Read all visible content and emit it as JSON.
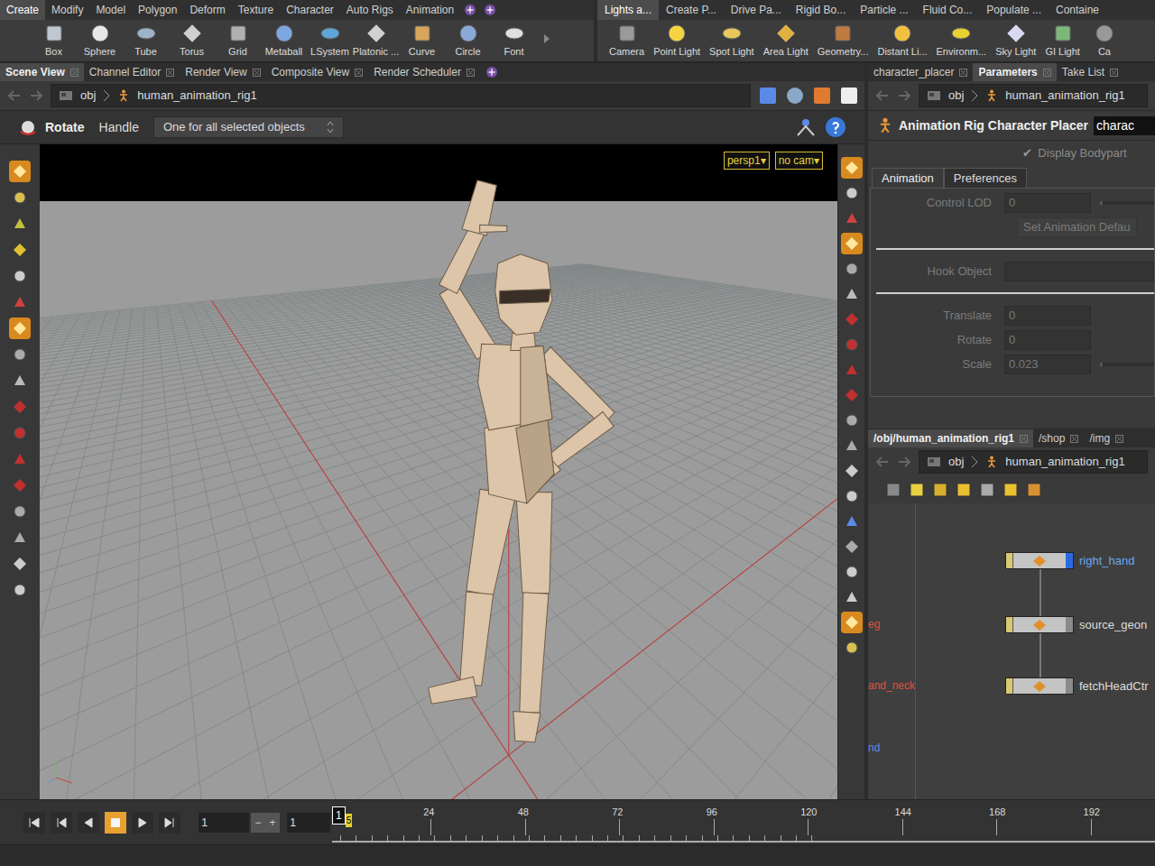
{
  "shelf_left": {
    "tabs": [
      {
        "label": "Create",
        "selected": true
      },
      {
        "label": "Modify",
        "selected": false
      },
      {
        "label": "Model",
        "selected": false
      },
      {
        "label": "Polygon",
        "selected": false
      },
      {
        "label": "Deform",
        "selected": false
      },
      {
        "label": "Texture",
        "selected": false
      },
      {
        "label": "Character",
        "selected": false
      },
      {
        "label": "Auto Rigs",
        "selected": false
      },
      {
        "label": "Animation",
        "selected": false
      }
    ],
    "tools": [
      "Box",
      "Sphere",
      "Tube",
      "Torus",
      "Grid",
      "Metaball",
      "LSystem",
      "Platonic ...",
      "Curve",
      "Circle",
      "Font"
    ]
  },
  "shelf_right": {
    "tabs": [
      {
        "label": "Lights a...",
        "selected": true
      },
      {
        "label": "Create P...",
        "selected": false
      },
      {
        "label": "Drive Pa...",
        "selected": false
      },
      {
        "label": "Rigid Bo...",
        "selected": false
      },
      {
        "label": "Particle ...",
        "selected": false
      },
      {
        "label": "Fluid Co...",
        "selected": false
      },
      {
        "label": "Populate ...",
        "selected": false
      },
      {
        "label": "Containe",
        "selected": false
      }
    ],
    "tools": [
      "Camera",
      "Point Light",
      "Spot Light",
      "Area Light",
      "Geometry...",
      "Distant Li...",
      "Environm...",
      "Sky Light",
      "GI Light",
      "Ca"
    ]
  },
  "scene_tabs": [
    {
      "label": "Scene View",
      "selected": true
    },
    {
      "label": "Channel Editor",
      "selected": false
    },
    {
      "label": "Render View",
      "selected": false
    },
    {
      "label": "Composite View",
      "selected": false
    },
    {
      "label": "Render Scheduler",
      "selected": false
    }
  ],
  "scene_path": {
    "root": "obj",
    "node": "human_animation_rig1"
  },
  "operation": {
    "tool": "Rotate",
    "mode": "Handle",
    "dropdown": "One for all selected objects"
  },
  "viewport": {
    "camera": "persp1",
    "view": "no cam",
    "dropdown_glyph": "▾"
  },
  "left_toolbar": [
    {
      "selected": true
    },
    {
      "selected": false
    },
    {
      "selected": false
    },
    {
      "selected": false
    },
    {
      "selected": false
    },
    {
      "selected": false
    },
    {
      "selected": true
    },
    {
      "selected": false
    },
    {
      "selected": false
    },
    {
      "selected": false
    },
    {
      "selected": false
    },
    {
      "selected": false
    },
    {
      "selected": false
    },
    {
      "selected": false
    },
    {
      "selected": false
    },
    {
      "selected": false
    },
    {
      "selected": false
    }
  ],
  "right_toolbar": [
    {
      "selected": true
    },
    {
      "selected": false
    },
    {
      "selected": false
    },
    {
      "selected": true
    },
    {
      "selected": false
    },
    {
      "selected": false
    },
    {
      "selected": false
    },
    {
      "selected": false
    },
    {
      "selected": false
    },
    {
      "selected": false
    },
    {
      "selected": false
    },
    {
      "selected": false
    },
    {
      "selected": false
    },
    {
      "selected": false
    },
    {
      "selected": false
    },
    {
      "selected": false
    },
    {
      "selected": false
    },
    {
      "selected": false
    },
    {
      "selected": true
    },
    {
      "selected": false
    }
  ],
  "param_tabs": [
    {
      "label": "character_placer",
      "selected": false
    },
    {
      "label": "Parameters",
      "selected": true
    },
    {
      "label": "Take List",
      "selected": false
    }
  ],
  "param_path": {
    "root": "obj",
    "node": "human_animation_rig1"
  },
  "parameters": {
    "type": "Animation Rig Character Placer",
    "name": "charac",
    "display_bodypart": {
      "label": "Display Bodypart",
      "checked": true
    },
    "tabs": [
      {
        "label": "Animation",
        "selected": true
      },
      {
        "label": "Preferences",
        "selected": false
      }
    ],
    "disabled": true,
    "rows": [
      {
        "kind": "slider",
        "label": "Control LOD",
        "value": "0"
      },
      {
        "kind": "button",
        "label": "Set Animation Defau"
      },
      {
        "kind": "separator"
      },
      {
        "kind": "text",
        "label": "Hook Object",
        "value": ""
      },
      {
        "kind": "separator"
      },
      {
        "kind": "number",
        "label": "Translate",
        "value": "0"
      },
      {
        "kind": "number",
        "label": "Rotate",
        "value": "0"
      },
      {
        "kind": "slider",
        "label": "Scale",
        "value": "0.023"
      }
    ]
  },
  "network_tabs": [
    {
      "label": "/obj/human_animation_rig1",
      "selected": true
    },
    {
      "label": "/shop",
      "selected": false
    },
    {
      "label": "/img",
      "selected": false
    }
  ],
  "network_path": {
    "root": "obj",
    "node": "human_animation_rig1"
  },
  "network": {
    "nodes": [
      {
        "name": "right_hand",
        "selected": true
      },
      {
        "name": "source_geon",
        "selected": false
      },
      {
        "name": "fetchHeadCtr",
        "selected": false
      }
    ],
    "side_labels": [
      {
        "text": "eg",
        "color": "#e0503c"
      },
      {
        "text": "and_neck",
        "color": "#e0503c"
      },
      {
        "text": "nd",
        "color": "#5a8ae6"
      }
    ]
  },
  "timeline": {
    "start_field": "1",
    "end_field": "1",
    "current_frame": "1",
    "marker": "5",
    "ticks": [
      "24",
      "48",
      "72",
      "96",
      "120",
      "144",
      "168",
      "192"
    ]
  }
}
